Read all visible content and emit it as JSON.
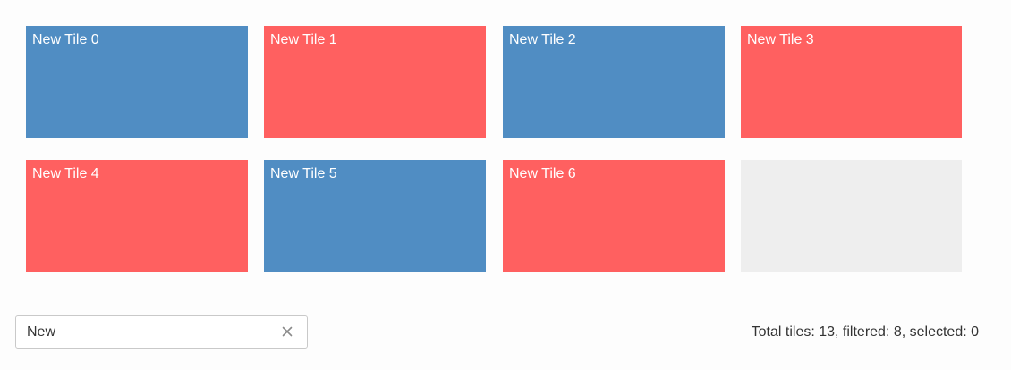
{
  "tiles": [
    {
      "label": "New Tile 0",
      "color": "#508dc3"
    },
    {
      "label": "New Tile 1",
      "color": "#ff6060"
    },
    {
      "label": "New Tile 2",
      "color": "#508dc3"
    },
    {
      "label": "New Tile 3",
      "color": "#ff6060"
    },
    {
      "label": "New Tile 4",
      "color": "#ff6060"
    },
    {
      "label": "New Tile 5",
      "color": "#508dc3"
    },
    {
      "label": "New Tile 6",
      "color": "#ff6060"
    },
    {
      "label": "",
      "color": "#eeeeee"
    }
  ],
  "filter": {
    "value": "New",
    "clear_icon": "close-icon"
  },
  "status": {
    "text": "Total tiles: 13, filtered: 8, selected: 0"
  }
}
